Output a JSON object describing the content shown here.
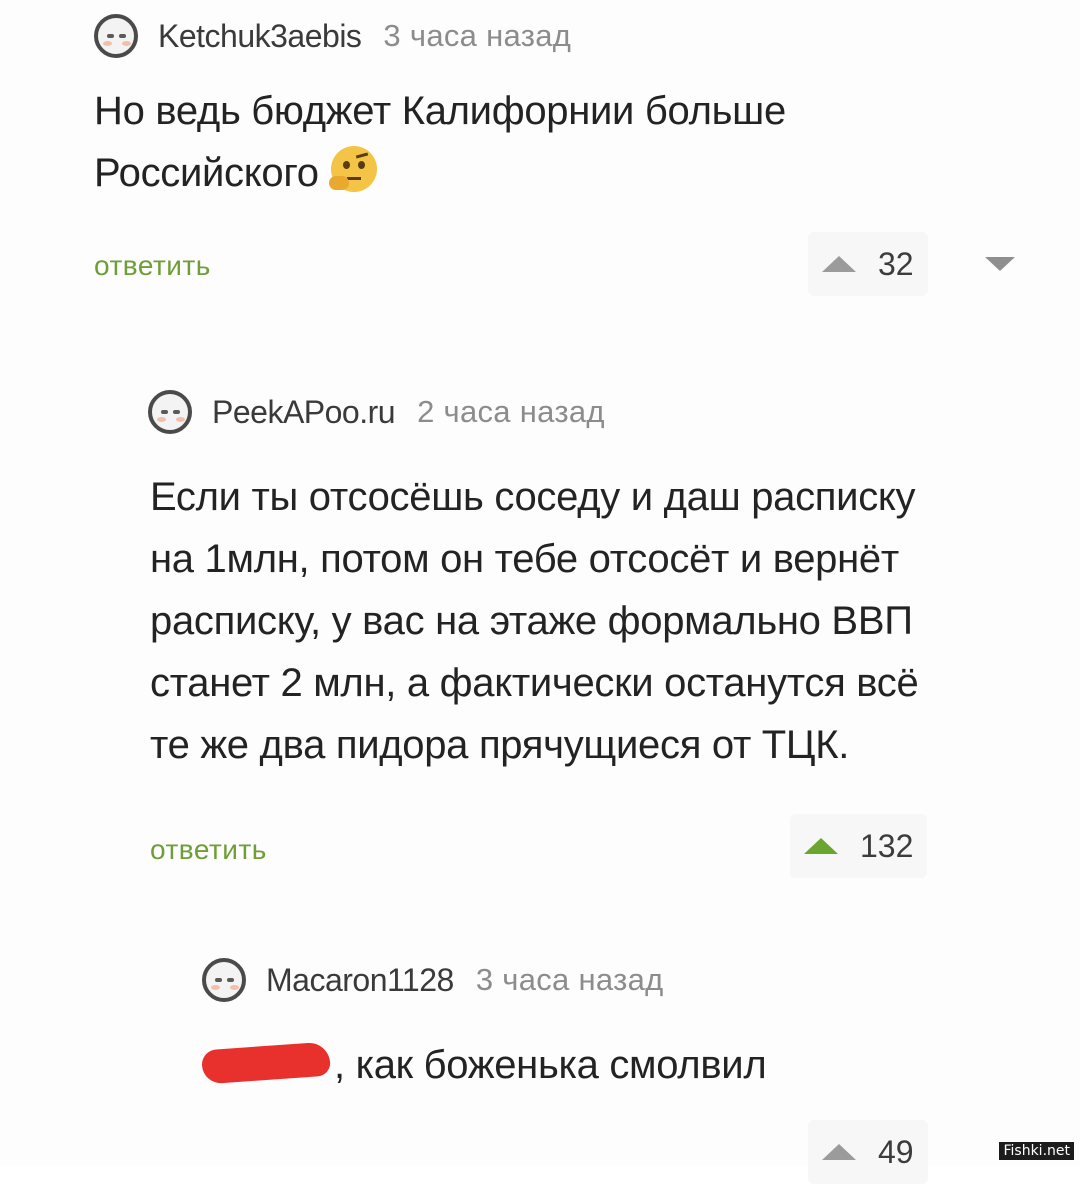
{
  "comments": [
    {
      "username": "Ketchuk3aebis",
      "time": "3 часа назад",
      "lines": [
        "Но ведь бюджет Калифорнии больше",
        "Российского"
      ],
      "emoji": "thinking-face-icon",
      "reply_label": "ответить",
      "score": "32"
    },
    {
      "username": "PeekAPoo.ru",
      "time": "2 часа назад",
      "lines": [
        "Если ты отсосёшь соседу и даш расписку",
        "на 1млн, потом он тебе отсосёт и вернёт",
        "расписку, у вас на этаже формально ВВП",
        "станет 2 млн, а фактически останутся всё",
        "те же два пидора прячущиеся от ТЦК."
      ],
      "reply_label": "ответить",
      "score": "132"
    },
    {
      "username": "Macaron1128",
      "time": "3 часа назад",
      "text_after_redaction": ", как боженька смолвил",
      "score": "49"
    }
  ],
  "watermark": "Fishki.net",
  "colors": {
    "reply_green": "#6f9e38",
    "upvote_green": "#6aa52f",
    "redaction_red": "#e8302d"
  }
}
